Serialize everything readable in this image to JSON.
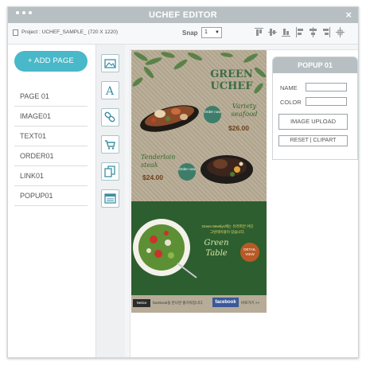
{
  "window": {
    "title": "UCHEF EDITOR",
    "close_glyph": "×"
  },
  "toolbar": {
    "project_label": "Project : UCHEF_SAMPLE_ (720 X 1220)",
    "snap_label": "Snap",
    "snap_value": "1",
    "align_icons": [
      "align-top-icon",
      "align-vmiddle-icon",
      "align-bottom-icon",
      "align-left-icon",
      "align-hcenter-icon",
      "align-right-icon",
      "align-center-icon"
    ]
  },
  "sidebar": {
    "add_page_label": "+ ADD PAGE",
    "items": [
      "PAGE 01",
      "IMAGE01",
      "TEXT01",
      "ORDER01",
      "LINK01",
      "POPUP01"
    ]
  },
  "tools": [
    "image-tool-icon",
    "text-tool-icon",
    "link-tool-icon",
    "cart-tool-icon",
    "copy-tool-icon",
    "popup-tool-icon"
  ],
  "design": {
    "brand_line1": "GREEN",
    "brand_line2": "UCHEF",
    "dish1_line1": "Variety",
    "dish1_line2": "seafood",
    "dish1_price": "$26.00",
    "order_now": "Order now",
    "dish2_line1": "Tenderloin",
    "dish2_line2": "steak",
    "dish2_price": "$24.00",
    "korean_line1": "Green Meetlys에는 유러피안 어딘",
    "korean_line2": "그린테이블이 있습니다.",
    "green_table_line1": "Green",
    "green_table_line2": "Table",
    "detail_view": "DETAIL VIEW",
    "footer_badge": "Netice",
    "footer_text": "facebook을 만나면 즐거워집니다.",
    "facebook_label": "facebook",
    "footer_more": "바로가기 >>",
    "colors": {
      "top_bg": "#b7ab94",
      "bottom_bg": "#2d5e2f",
      "accent": "#49b8c9"
    }
  },
  "popup": {
    "title": "POPUP 01",
    "name_label": "NAME",
    "name_value": "",
    "color_label": "COLOR",
    "color_value": "",
    "image_upload": "IMAGE UPLOAD",
    "reset_clipart": "RESET  |  CLIPART"
  }
}
